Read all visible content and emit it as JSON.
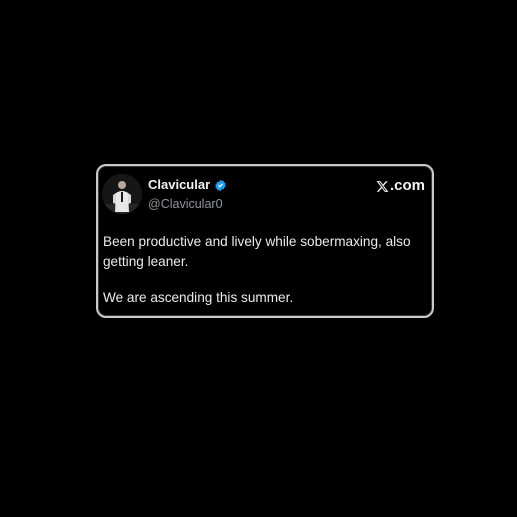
{
  "tweet": {
    "display_name": "Clavicular",
    "handle": "@Clavicular0",
    "verified": true,
    "brand_label": ".com",
    "paragraphs": [
      "Been productive and lively while sobermaxing, also getting leaner.",
      "We are ascending this summer."
    ]
  },
  "icons": {
    "verified": "verified-badge-icon",
    "brand": "x-logo-icon"
  },
  "colors": {
    "background": "#000000",
    "card_border": "#c9c9c9",
    "verified_blue": "#1d9bf0",
    "text_primary": "#f2f2f2",
    "text_secondary": "#8f959b"
  }
}
